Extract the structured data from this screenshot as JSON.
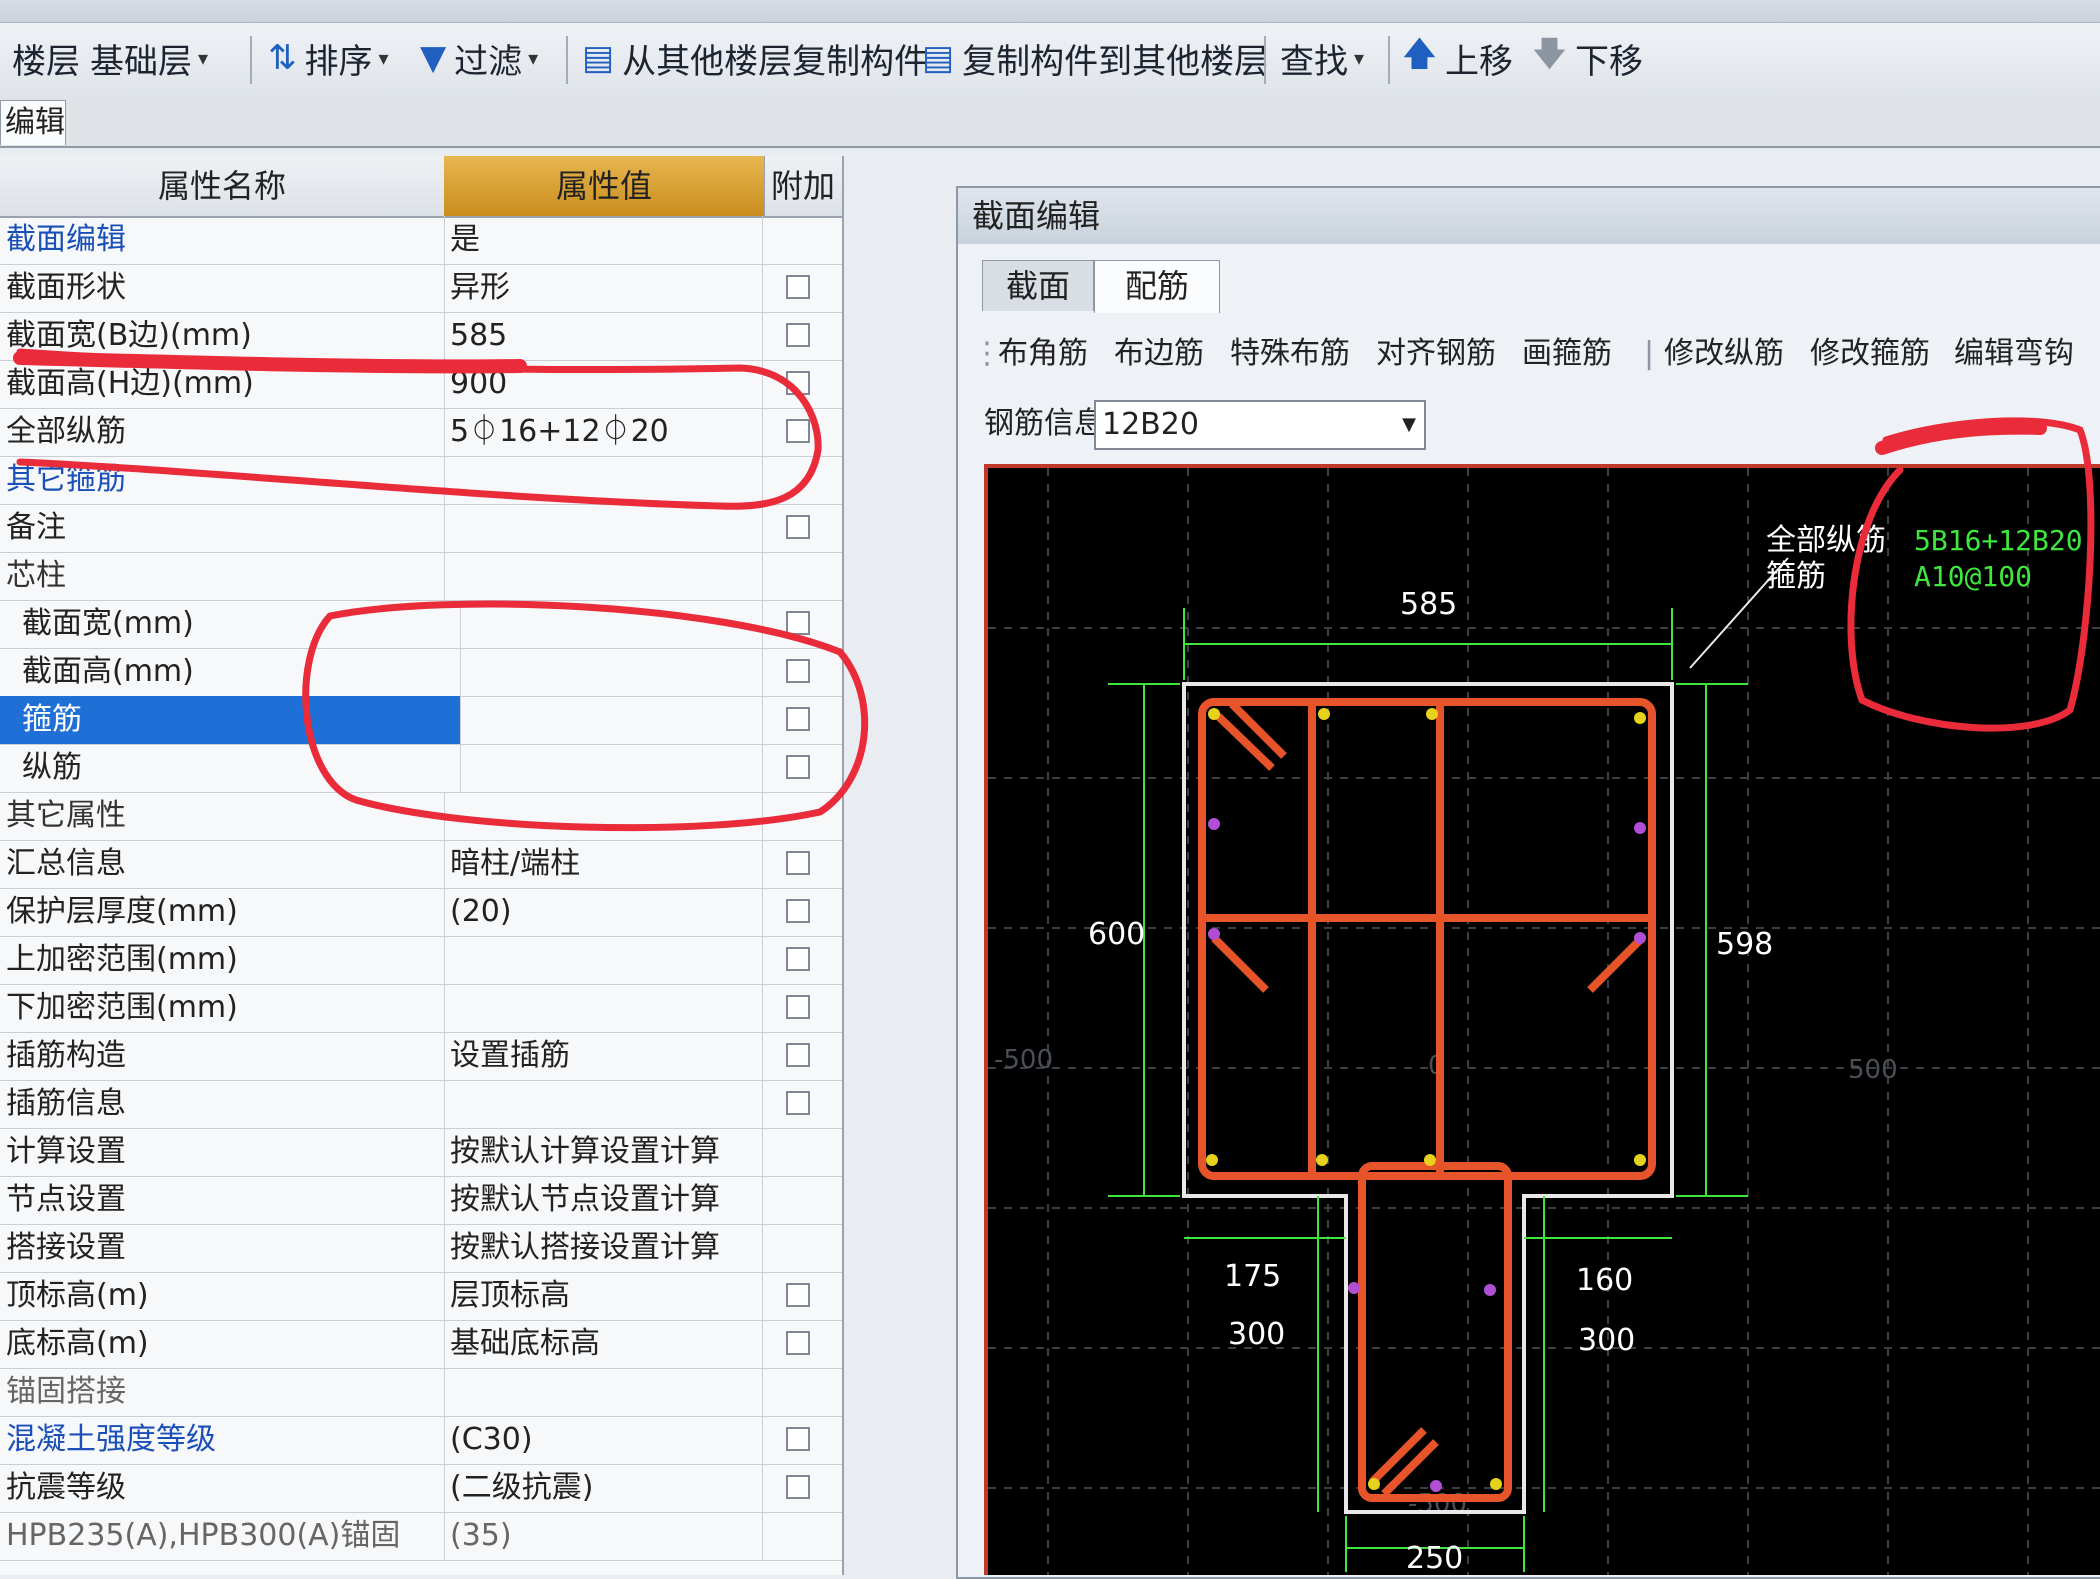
{
  "toolbar": {
    "floor_label": "楼层",
    "floor_value": "基础层",
    "sort_label": "排序",
    "filter_label": "过滤",
    "copy_from_label": "从其他楼层复制构件",
    "copy_to_label": "复制构件到其他楼层",
    "find_label": "查找",
    "move_up_label": "上移",
    "move_down_label": "下移"
  },
  "tabstrip": {
    "tab_label": "编辑"
  },
  "grid": {
    "header_name": "属性名称",
    "header_value": "属性值",
    "header_extra": "附加",
    "rows": [
      {
        "name": "截面编辑",
        "value": "是"
      },
      {
        "name": "截面形状",
        "value": "异形"
      },
      {
        "name": "截面宽(B边)(mm)",
        "value": "585"
      },
      {
        "name": "截面高(H边)(mm)",
        "value": "900"
      },
      {
        "name": "全部纵筋",
        "value": "5⏀16+12⏀20"
      },
      {
        "name": "其它箍筋",
        "value": ""
      },
      {
        "name": "备注",
        "value": ""
      },
      {
        "name": "芯柱",
        "value": ""
      },
      {
        "name": "截面宽(mm)",
        "value": ""
      },
      {
        "name": "截面高(mm)",
        "value": ""
      },
      {
        "name": "箍筋",
        "value": ""
      },
      {
        "name": "纵筋",
        "value": ""
      },
      {
        "name": "其它属性",
        "value": ""
      },
      {
        "name": "汇总信息",
        "value": "暗柱/端柱"
      },
      {
        "name": "保护层厚度(mm)",
        "value": "(20)"
      },
      {
        "name": "上加密范围(mm)",
        "value": ""
      },
      {
        "name": "下加密范围(mm)",
        "value": ""
      },
      {
        "name": "插筋构造",
        "value": "设置插筋"
      },
      {
        "name": "插筋信息",
        "value": ""
      },
      {
        "name": "计算设置",
        "value": "按默认计算设置计算"
      },
      {
        "name": "节点设置",
        "value": "按默认节点设置计算"
      },
      {
        "name": "搭接设置",
        "value": "按默认搭接设置计算"
      },
      {
        "name": "顶标高(m)",
        "value": "层顶标高"
      },
      {
        "name": "底标高(m)",
        "value": "基础底标高"
      },
      {
        "name": "锚固搭接",
        "value": ""
      },
      {
        "name": "混凝土强度等级",
        "value": "(C30)"
      },
      {
        "name": "抗震等级",
        "value": "(二级抗震)"
      },
      {
        "name": "HPB235(A),HPB300(A)锚固",
        "value": "(35)"
      }
    ]
  },
  "panel": {
    "title": "截面编辑",
    "tab_section": "截面",
    "tab_rebar": "配筋",
    "tools": [
      "布角筋",
      "布边筋",
      "特殊布筋",
      "对齐钢筋",
      "画箍筋",
      "修改纵筋",
      "修改箍筋",
      "编辑弯钩"
    ],
    "rebar_info_label": "钢筋信息",
    "rebar_info_value": "12B20"
  },
  "drawing": {
    "legend_longitudinal_label": "全部纵筋",
    "legend_longitudinal_value": "5B16+12B20",
    "legend_stirrup_label": "箍筋",
    "legend_stirrup_value": "A10@100",
    "dim_top": "585",
    "dim_left": "600",
    "dim_right": "598",
    "dim_stem_left": "175",
    "dim_stem_right": "160",
    "dim_stem_height_left": "300",
    "dim_stem_height_right": "300",
    "dim_bottom": "250",
    "axis_left": "-500",
    "axis_right": "500",
    "axis_origin": "0",
    "axis_bottom": "-500",
    "colors": {
      "outline": "#e8e8e8",
      "stirrup": "#e8542a",
      "dimension": "#3ee63e",
      "bar_corner": "#e6d21c",
      "bar_side": "#b04fd6"
    }
  }
}
